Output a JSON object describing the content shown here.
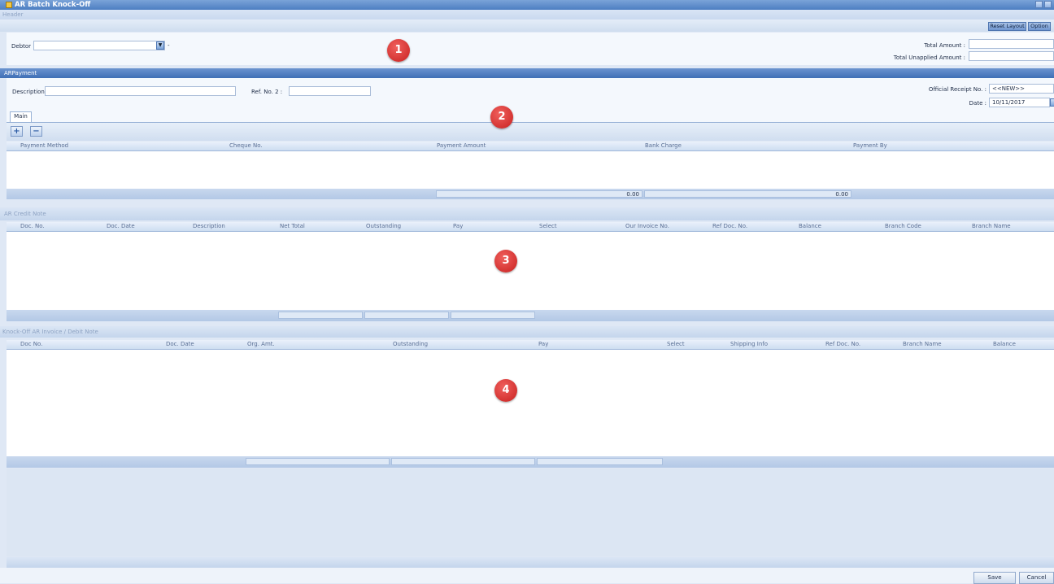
{
  "window": {
    "title": "AR Batch Knock-Off"
  },
  "header_section": {
    "label": "Header",
    "reset_layout": "Reset Layout",
    "option": "Option",
    "debtor_label": "Debtor",
    "debtor_value": "",
    "debtor_dash": "-",
    "total_amount_label": "Total Amount :",
    "total_unapplied_label": "Total Unapplied Amount :"
  },
  "payment_section": {
    "label": "ARPayment",
    "description_label": "Description",
    "ref_no2_label": "Ref. No. 2 :",
    "official_receipt_label": "Official Receipt No. :",
    "official_receipt_value": "<<NEW>>",
    "date_label": "Date :",
    "date_value": "10/11/2017",
    "tab_main": "Main",
    "add_symbol": "+",
    "remove_symbol": "−",
    "columns": [
      "Payment Method",
      "Cheque No.",
      "Payment Amount",
      "Bank Charge",
      "Payment By"
    ],
    "total_payment_amount": "0.00",
    "total_bank_charge": "0.00"
  },
  "credit_note_section": {
    "label": "AR Credit Note",
    "columns": [
      "Doc. No.",
      "Doc. Date",
      "Description",
      "Net Total",
      "Outstanding",
      "Pay",
      "Select",
      "Our Invoice No.",
      "Ref Doc. No.",
      "Balance",
      "Branch Code",
      "Branch Name"
    ]
  },
  "knockoff_section": {
    "label": "Knock-Off AR Invoice / Debit Note",
    "columns": [
      "Doc No.",
      "Doc. Date",
      "Org. Amt.",
      "Outstanding",
      "Pay",
      "Select",
      "Shipping Info",
      "Ref Doc. No.",
      "Branch Name",
      "Balance"
    ]
  },
  "markers": [
    "1",
    "2",
    "3",
    "4"
  ],
  "footer": {
    "save": "Save",
    "cancel": "Cancel"
  }
}
